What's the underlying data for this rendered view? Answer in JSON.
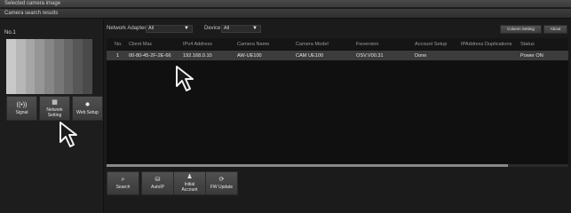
{
  "window": {
    "title": "Selected camera image",
    "subtitle": "Camera search results"
  },
  "left": {
    "no_label": "No.1",
    "thumb_colors": [
      "#c9c9c9",
      "#b7b7b7",
      "#a6a6a6",
      "#969696",
      "#868686",
      "#767676",
      "#666666",
      "#575757",
      "#4a4a4a"
    ],
    "buttons": [
      {
        "label": "Signal",
        "icon": "((•))"
      },
      {
        "label": "Network\nSetting",
        "icon": "▦"
      },
      {
        "label": "Web Setup",
        "icon": "✹"
      }
    ]
  },
  "filters": {
    "network_label": "Network Adapter",
    "network_value": "All",
    "device_label": "Device",
    "device_value": "All",
    "column_setting": "Column Setting",
    "about": "About"
  },
  "table": {
    "headers": [
      "No.",
      "Client Mac",
      "IPv4 Address",
      "Camera Name",
      "Camera Model",
      "Fwversion",
      "Account Setup",
      "IPAddress Duplications",
      "Status"
    ],
    "rows": [
      [
        "1",
        "00-80-45-2F-2E-66",
        "192.168.0.10",
        "AW-UE100",
        "CAM UE100",
        "OSV.V00.31",
        "Done",
        "",
        "Power ON"
      ]
    ]
  },
  "bottom_buttons": [
    {
      "label": "Search",
      "icon": "⌕"
    },
    {
      "label": "AutoIP",
      "icon": "⛁"
    },
    {
      "label": "Initial\nAccount",
      "icon": "♟"
    },
    {
      "label": "FW Update",
      "icon": "⟳"
    }
  ]
}
